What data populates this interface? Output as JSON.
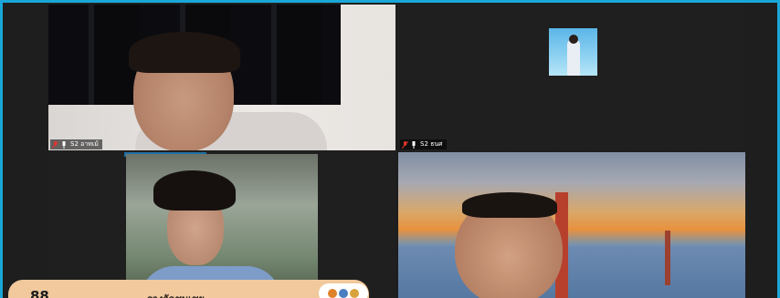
{
  "participants": [
    {
      "name": "S2 อาทเม้",
      "muted": true
    },
    {
      "name": "S2 ธนศ",
      "muted": true
    },
    {
      "name": "",
      "muted": false
    },
    {
      "name": "",
      "muted": false
    }
  ],
  "banner": {
    "icon_text": "88",
    "text": "รางวัลชมเชย"
  },
  "colors": {
    "frame_border": "#1aa7d8",
    "mute_red": "#e0352b",
    "banner_bg": "#f1c99d"
  },
  "icons": [
    "microphone-muted-icon",
    "pin-icon"
  ]
}
